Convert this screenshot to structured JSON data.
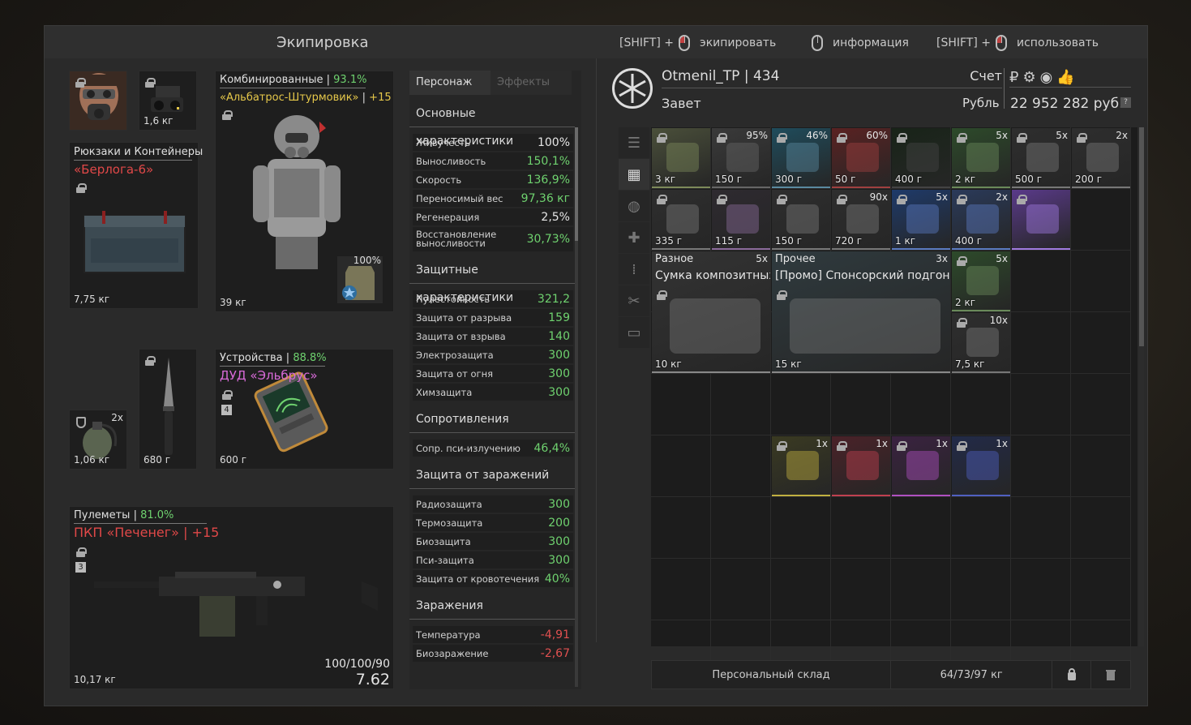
{
  "header": {
    "title": "Экипировка",
    "hints": [
      {
        "prefix": "[SHIFT] +",
        "label": "экипировать"
      },
      {
        "prefix": "",
        "label": "информация"
      },
      {
        "prefix": "[SHIFT] +",
        "label": "использовать"
      }
    ]
  },
  "equipment": {
    "head_weight": "1,6 кг",
    "backpack": {
      "category": "Рюкзаки и Контейнеры",
      "name": "«Берлога-6»",
      "weight": "7,75 кг"
    },
    "armor": {
      "category": "Комбинированные",
      "condition": "93.1%",
      "name": "«Альбатрос-Штурмовик»",
      "upgrade": "+15",
      "weight": "39 кг",
      "plate": "100%"
    },
    "grenade": {
      "count": "2x",
      "weight": "1,06 кг"
    },
    "knife": {
      "weight": "680 г"
    },
    "device": {
      "category": "Устройства",
      "condition": "88.8%",
      "name": "ДУД «Эльбрус»",
      "rank": "4",
      "weight": "600 г"
    },
    "weapon": {
      "category": "Пулеметы",
      "condition": "81.0%",
      "name": "ПКП «Печенег»",
      "upgrade": "+15",
      "rank": "3",
      "ammo": "100/100/90",
      "caliber": "7.62",
      "weight": "10,17 кг"
    }
  },
  "stats": {
    "tabs": [
      "Персонаж",
      "Эффекты"
    ],
    "groups": [
      {
        "title": "Основные характеристики",
        "rows": [
          {
            "label": "Живучесть",
            "value": "100%",
            "tone": "w"
          },
          {
            "label": "Выносливость",
            "value": "150,1%",
            "tone": "g"
          },
          {
            "label": "Скорость",
            "value": "136,9%",
            "tone": "g"
          },
          {
            "label": "Переносимый вес",
            "value": "97,36 кг",
            "tone": "g"
          },
          {
            "label": "Регенерация",
            "value": "2,5%",
            "tone": "w"
          },
          {
            "label": "Восстановление выносливости",
            "value": "30,73%",
            "tone": "g"
          }
        ]
      },
      {
        "title": "Защитные характеристики",
        "rows": [
          {
            "label": "Пулестойкость",
            "value": "321,2",
            "tone": "g"
          },
          {
            "label": "Защита от разрыва",
            "value": "159",
            "tone": "g"
          },
          {
            "label": "Защита от взрыва",
            "value": "140",
            "tone": "g"
          },
          {
            "label": "Электрозащита",
            "value": "300",
            "tone": "g"
          },
          {
            "label": "Защита от огня",
            "value": "300",
            "tone": "g"
          },
          {
            "label": "Химзащита",
            "value": "300",
            "tone": "g"
          }
        ]
      },
      {
        "title": "Сопротивления",
        "rows": [
          {
            "label": "Сопр. пси-излучению",
            "value": "46,4%",
            "tone": "g"
          }
        ]
      },
      {
        "title": "Защита от заражений",
        "rows": [
          {
            "label": "Радиозащита",
            "value": "300",
            "tone": "g"
          },
          {
            "label": "Термозащита",
            "value": "200",
            "tone": "g"
          },
          {
            "label": "Биозащита",
            "value": "300",
            "tone": "g"
          },
          {
            "label": "Пси-защита",
            "value": "300",
            "tone": "g"
          },
          {
            "label": "Защита от кровотечения",
            "value": "40%",
            "tone": "g"
          }
        ]
      },
      {
        "title": "Заражения",
        "rows": [
          {
            "label": "Температура",
            "value": "-4,91",
            "tone": "r"
          },
          {
            "label": "Биозаражение",
            "value": "-2,67",
            "tone": "r"
          }
        ]
      }
    ]
  },
  "profile": {
    "name": "Otmenil_TP",
    "level": "434",
    "faction": "Завет",
    "account_label": "Счет",
    "currency_label": "Рубль",
    "balance": "22 952 282 руб.",
    "help": "?"
  },
  "inventory": {
    "items": [
      {
        "col": 0,
        "row": 0,
        "w": 1,
        "h": 1,
        "weight": "3 кг",
        "count": "",
        "color": "#4a4f3a",
        "border": "#7d8a5a"
      },
      {
        "col": 1,
        "row": 0,
        "w": 1,
        "h": 1,
        "weight": "150 г",
        "count": "95%",
        "color": "#3a3a3a",
        "border": "#666"
      },
      {
        "col": 2,
        "row": 0,
        "w": 1,
        "h": 1,
        "weight": "300 г",
        "count": "46%",
        "color": "#1f4c5c",
        "border": "#5a8aa0"
      },
      {
        "col": 3,
        "row": 0,
        "w": 1,
        "h": 1,
        "weight": "50 г",
        "count": "60%",
        "color": "#5a2222",
        "border": "#a04040"
      },
      {
        "col": 4,
        "row": 0,
        "w": 1,
        "h": 1,
        "weight": "400 г",
        "count": "",
        "color": "#182418",
        "border": "#444"
      },
      {
        "col": 5,
        "row": 0,
        "w": 1,
        "h": 1,
        "weight": "2 кг",
        "count": "5x",
        "color": "#2d4a2a",
        "border": "#6a8a5a"
      },
      {
        "col": 6,
        "row": 0,
        "w": 1,
        "h": 1,
        "weight": "500 г",
        "count": "5x",
        "color": "#2e2e2e",
        "border": "#777"
      },
      {
        "col": 7,
        "row": 0,
        "w": 1,
        "h": 1,
        "weight": "200 г",
        "count": "2x",
        "color": "#2e2e2e",
        "border": "#777"
      },
      {
        "col": 0,
        "row": 1,
        "w": 1,
        "h": 1,
        "weight": "335 г",
        "count": "",
        "color": "#2e2e2e",
        "border": "#777"
      },
      {
        "col": 1,
        "row": 1,
        "w": 1,
        "h": 1,
        "weight": "115 г",
        "count": "",
        "color": "#2e2a30",
        "border": "#8a6a9a"
      },
      {
        "col": 2,
        "row": 1,
        "w": 1,
        "h": 1,
        "weight": "150 г",
        "count": "",
        "color": "#2e2e2e",
        "border": "#777"
      },
      {
        "col": 3,
        "row": 1,
        "w": 1,
        "h": 1,
        "weight": "720 г",
        "count": "90x",
        "color": "#2e2e2e",
        "border": "#777"
      },
      {
        "col": 4,
        "row": 1,
        "w": 1,
        "h": 1,
        "weight": "1 кг",
        "count": "5x",
        "color": "#1e3a6a",
        "border": "#5a7ac0"
      },
      {
        "col": 5,
        "row": 1,
        "w": 1,
        "h": 1,
        "weight": "400 г",
        "count": "2x",
        "color": "#2a3a5a",
        "border": "#5a7ac0"
      },
      {
        "col": 6,
        "row": 1,
        "w": 1,
        "h": 1,
        "weight": "",
        "count": "",
        "color": "#5a3a8a",
        "border": "#a07ae0"
      },
      {
        "col": 0,
        "row": 2,
        "w": 2,
        "h": 2,
        "weight": "10 кг",
        "count": "5x",
        "label": "Разное",
        "title": "Сумка композитных",
        "color": "#333",
        "border": "#888"
      },
      {
        "col": 2,
        "row": 2,
        "w": 3,
        "h": 2,
        "weight": "15 кг",
        "count": "3x",
        "label": "Прочее",
        "title": "[Промо] Спонсорский подгон",
        "color": "#2f3a3e",
        "border": "#888"
      },
      {
        "col": 5,
        "row": 2,
        "w": 1,
        "h": 1,
        "weight": "2 кг",
        "count": "5x",
        "color": "#2d4a2a",
        "border": "#6a8a5a"
      },
      {
        "col": 5,
        "row": 3,
        "w": 1,
        "h": 1,
        "weight": "7,5 кг",
        "count": "10x",
        "color": "#2e2e2e",
        "border": "#777"
      },
      {
        "col": 2,
        "row": 5,
        "w": 1,
        "h": 1,
        "weight": "",
        "count": "1x",
        "color": "#3a3a22",
        "border": "#c0b040"
      },
      {
        "col": 3,
        "row": 5,
        "w": 1,
        "h": 1,
        "weight": "",
        "count": "1x",
        "color": "#4a2228",
        "border": "#c04050"
      },
      {
        "col": 4,
        "row": 5,
        "w": 1,
        "h": 1,
        "weight": "",
        "count": "1x",
        "color": "#3a2240",
        "border": "#b050c0"
      },
      {
        "col": 5,
        "row": 5,
        "w": 1,
        "h": 1,
        "weight": "",
        "count": "1x",
        "color": "#222a48",
        "border": "#5060c0"
      }
    ]
  },
  "storage": {
    "label": "Персональный склад",
    "capacity": "64/73/97 кг"
  }
}
